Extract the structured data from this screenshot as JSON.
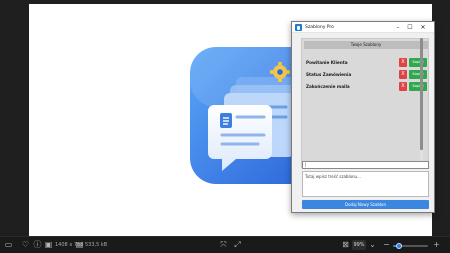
{
  "viewer": {
    "status": {
      "dimensions": "1408 x 768",
      "file_size": "533,5 kB",
      "zoom": "99%",
      "zoom_fraction": 0.17
    },
    "icons": {
      "monitor": "monitor-icon",
      "heart": "heart-icon",
      "info": "info-icon",
      "image": "image-icon",
      "fit": "fit-screen-icon",
      "fullscreen": "fullscreen-icon",
      "aspect": "aspect-ratio-icon",
      "zoom_out": "zoom-out-icon",
      "zoom_in": "zoom-in-icon"
    }
  },
  "window": {
    "title": "Szablony Pro",
    "controls": {
      "minimize": "–",
      "maximize": "☐",
      "close": "✕"
    },
    "header": "Twoje Szablony",
    "templates": [
      {
        "name": "Powitanie Klienta",
        "delete_label": "X",
        "copy_label": "Kopiuj"
      },
      {
        "name": "Status Zamówienia",
        "delete_label": "X",
        "copy_label": "Kopiuj"
      },
      {
        "name": "Zakończenie maila",
        "delete_label": "X",
        "copy_label": "Kopiuj"
      }
    ],
    "name_input": {
      "value": "|"
    },
    "content_input": {
      "placeholder": "Tutaj wpisz treść szablonu..."
    },
    "add_button": "Dodaj Nowy Szablon"
  },
  "colors": {
    "accent": "#3a86e0",
    "delete": "#e04343",
    "copy": "#2fa84f"
  }
}
